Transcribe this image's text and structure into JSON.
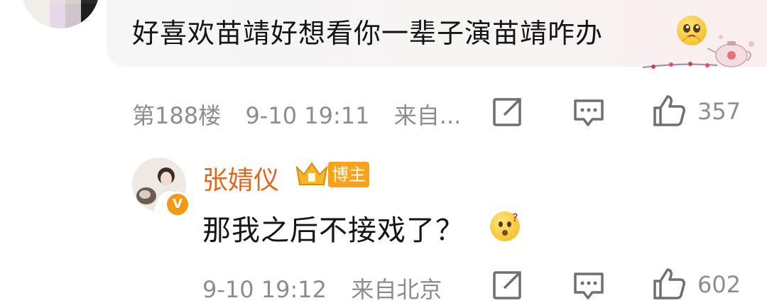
{
  "comment": {
    "text": "好喜欢苗靖好想看你一辈子演苗靖咋办",
    "floor": "第188楼",
    "time": "9-10 19:11",
    "source": "来自...",
    "likes": "357",
    "emoji": "pleading-face"
  },
  "reply": {
    "username": "张婧仪",
    "badge": "博主",
    "text": "那我之后不接戏了？",
    "emoji": "thinking-question-face",
    "time": "9-10 19:12",
    "source": "来自北京",
    "likes": "602"
  },
  "colors": {
    "username": "#e0681d",
    "badge": "#f7a21a",
    "meta_text": "#8d8d8d",
    "verified": "#f39a0f"
  },
  "icons": [
    "share-icon",
    "comment-icon",
    "like-icon",
    "crown-icon",
    "verified-icon"
  ]
}
